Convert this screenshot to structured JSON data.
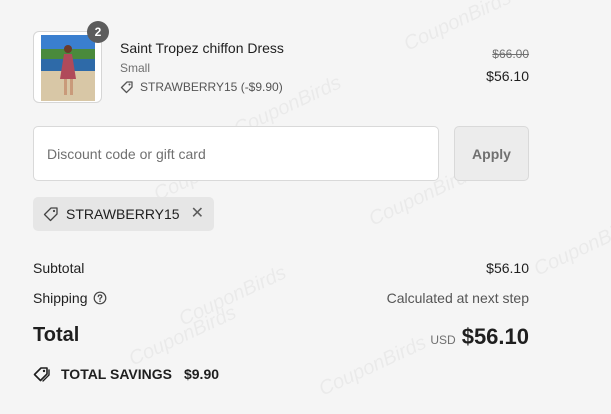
{
  "watermark": "CouponBirds",
  "line_item": {
    "quantity": "2",
    "name": "Saint Tropez chiffon Dress",
    "variant": "Small",
    "discount_label": "STRAWBERRY15 (-$9.90)",
    "original_price": "$66.00",
    "price": "$56.10",
    "image_icon": "dress-photo"
  },
  "discount": {
    "placeholder": "Discount code or gift card",
    "value": "",
    "apply_label": "Apply"
  },
  "applied_code": {
    "code": "STRAWBERRY15",
    "remove_glyph": "✕"
  },
  "summary": {
    "subtotal_label": "Subtotal",
    "subtotal_value": "$56.10",
    "shipping_label": "Shipping",
    "shipping_value": "Calculated at next step",
    "total_label": "Total",
    "currency": "USD",
    "total_value": "$56.10",
    "savings_label": "TOTAL SAVINGS",
    "savings_value": "$9.90"
  },
  "colors": {
    "background": "#f5f5f5",
    "text": "#1f1f1f",
    "muted": "#707070",
    "chip": "#e6e6e6"
  }
}
